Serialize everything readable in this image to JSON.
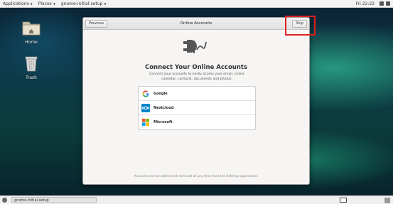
{
  "topbar": {
    "applications": "Applications",
    "places": "Places",
    "app_name": "gnome-initial-setup",
    "clock": "Fri 22:22"
  },
  "desktop": {
    "home_label": "Home",
    "trash_label": "Trash"
  },
  "dialog": {
    "title": "Online Accounts",
    "previous_label": "Previous",
    "skip_label": "Skip",
    "heading": "Connect Your Online Accounts",
    "description": "Connect your accounts to easily access your email, online calendar, contacts, documents and photos.",
    "providers": [
      {
        "label": "Google",
        "icon": "google-icon"
      },
      {
        "label": "Nextcloud",
        "icon": "nextcloud-icon"
      },
      {
        "label": "Microsoft",
        "icon": "microsoft-icon"
      }
    ],
    "footer": "Accounts can be added and removed at any time from the Settings application."
  },
  "taskbar": {
    "window_label": "gnome-initial-setup"
  },
  "colors": {
    "accent_highlight": "#e0201e",
    "nextcloud_blue": "#0082c9"
  }
}
